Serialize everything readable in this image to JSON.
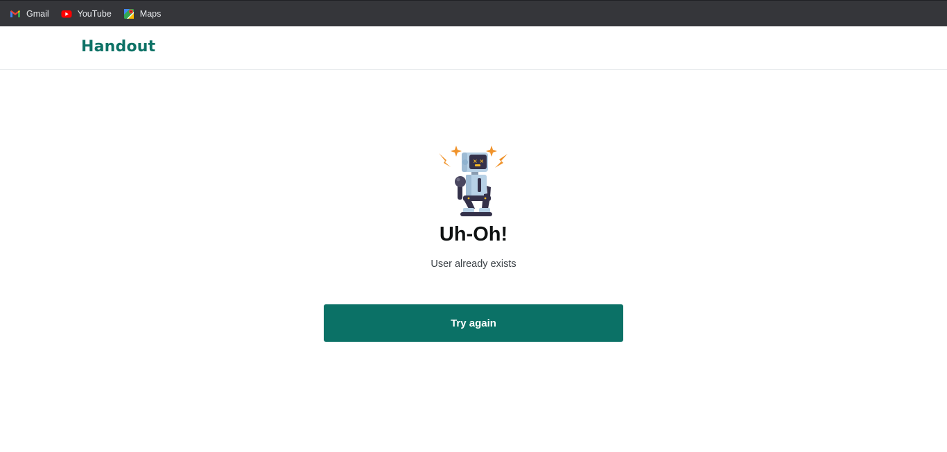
{
  "bookmarks": [
    {
      "label": "Gmail",
      "icon": "gmail-icon"
    },
    {
      "label": "YouTube",
      "icon": "youtube-icon"
    },
    {
      "label": "Maps",
      "icon": "maps-icon"
    }
  ],
  "header": {
    "logo_text": "Handout"
  },
  "error": {
    "illustration": "broken-robot-icon",
    "title": "Uh-Oh!",
    "message": "User already exists",
    "button_label": "Try again"
  },
  "colors": {
    "brand": "#0d7266",
    "button": "#0b7166",
    "bookmarks_bar": "#35363a"
  }
}
